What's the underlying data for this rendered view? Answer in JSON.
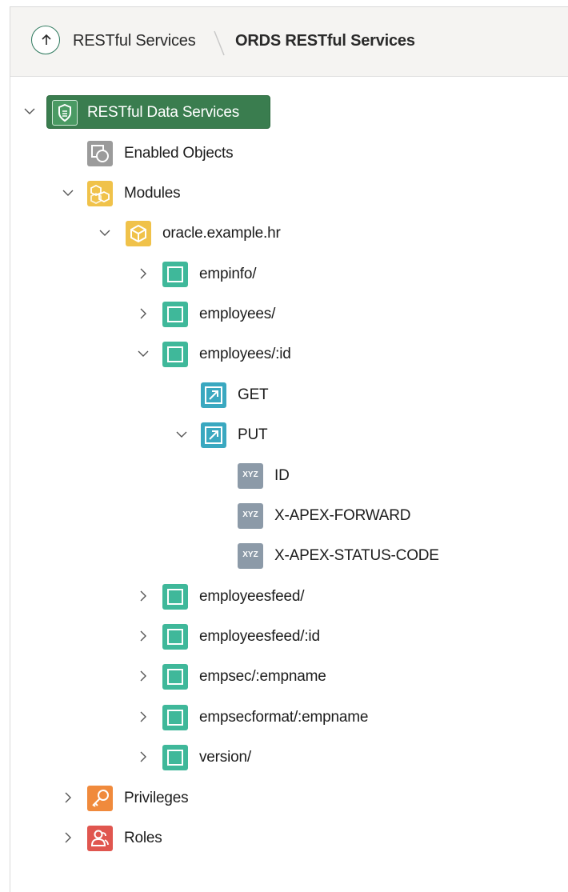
{
  "header": {
    "breadcrumb": [
      "RESTful Services",
      "ORDS RESTful Services"
    ]
  },
  "tree": {
    "root": {
      "label": "RESTful Data Services",
      "icon": "shield-icon",
      "expanded": true
    },
    "enabled_objects": {
      "label": "Enabled Objects",
      "icon": "enabled-objects-icon"
    },
    "modules": {
      "label": "Modules",
      "icon": "modules-icon",
      "expanded": true
    },
    "module": {
      "label": "oracle.example.hr",
      "icon": "module-icon",
      "expanded": true
    },
    "templates": [
      {
        "label": "empinfo/",
        "expanded": false
      },
      {
        "label": "employees/",
        "expanded": false
      },
      {
        "label": "employees/:id",
        "expanded": true
      },
      {
        "label": "employeesfeed/",
        "expanded": false
      },
      {
        "label": "employeesfeed/:id",
        "expanded": false
      },
      {
        "label": "empsec/:empname",
        "expanded": false
      },
      {
        "label": "empsecformat/:empname",
        "expanded": false
      },
      {
        "label": "version/",
        "expanded": false
      }
    ],
    "handlers": [
      {
        "label": "GET",
        "expanded": false
      },
      {
        "label": "PUT",
        "expanded": true
      }
    ],
    "params": [
      {
        "label": "ID",
        "badge": "XYZ"
      },
      {
        "label": "X-APEX-FORWARD",
        "badge": "XYZ"
      },
      {
        "label": "X-APEX-STATUS-CODE",
        "badge": "XYZ"
      }
    ],
    "privileges": {
      "label": "Privileges",
      "icon": "privileges-icon"
    },
    "roles": {
      "label": "Roles",
      "icon": "roles-icon"
    }
  },
  "colors": {
    "root_bg": "#3a7d4f",
    "template_icon": "#3fb89a",
    "handler_icon": "#3aa8c0",
    "param_icon": "#8c9aa8",
    "modules_icon": "#f0c24a",
    "privileges_icon": "#f08a3c",
    "roles_icon": "#e0564f"
  }
}
